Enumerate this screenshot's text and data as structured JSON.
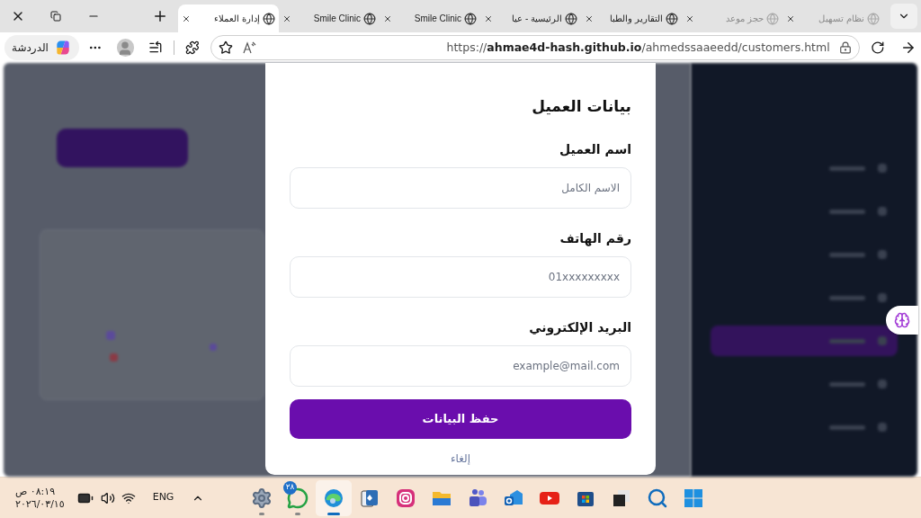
{
  "tabs": [
    {
      "title": "نظام تسهيل",
      "selected": false,
      "dimmed": true
    },
    {
      "title": "حجز موعد",
      "selected": false,
      "dimmed": true
    },
    {
      "title": "التقارير والطبا",
      "selected": false,
      "dimmed": false
    },
    {
      "title": "الرئيسية - عيا",
      "selected": false,
      "dimmed": false
    },
    {
      "title": "Smile Clinic",
      "selected": false,
      "dimmed": false
    },
    {
      "title": "Smile Clinic",
      "selected": false,
      "dimmed": false
    },
    {
      "title": "إدارة العملاء",
      "selected": true,
      "dimmed": false
    }
  ],
  "toolbar": {
    "copilot_label": "الدردشة",
    "url": "https://**ahmae4d-hash.github.io**/ahmedssaaeedd/customers.html"
  },
  "sidebar": {
    "items": [
      {
        "selected": false
      },
      {
        "selected": false
      },
      {
        "selected": false
      },
      {
        "selected": false
      },
      {
        "selected": true
      },
      {
        "selected": false
      },
      {
        "selected": false
      }
    ]
  },
  "modal": {
    "title": "بيانات العميل",
    "fields": [
      {
        "label": "اسم العميل",
        "placeholder": "الاسم الكامل"
      },
      {
        "label": "رقم الهاتف",
        "placeholder": "01xxxxxxxxx"
      },
      {
        "label": "البريد الإلكتروني",
        "placeholder": "example@mail.com"
      }
    ],
    "save_button": "حفظ البيانات",
    "cancel_link": "إلغاء"
  },
  "taskbar": {
    "time": "٠٨:١٩ ص",
    "date": "٢٠٢٦/٠٣/١٥",
    "language": "ENG",
    "apps": [
      {
        "kind": "settings",
        "open": true,
        "focused": false
      },
      {
        "kind": "whatsapp",
        "open": true,
        "focused": false,
        "badge": "٢٨"
      },
      {
        "kind": "edge",
        "open": true,
        "focused": true
      },
      {
        "kind": "solitaire",
        "open": false,
        "focused": false
      },
      {
        "kind": "instagram",
        "open": false,
        "focused": false
      },
      {
        "kind": "folder",
        "open": false,
        "focused": false
      },
      {
        "kind": "teams",
        "open": false,
        "focused": false
      },
      {
        "kind": "outlook",
        "open": false,
        "focused": false
      },
      {
        "kind": "youtube",
        "open": false,
        "focused": false
      },
      {
        "kind": "store",
        "open": false,
        "focused": false
      },
      {
        "kind": "taskview",
        "open": false,
        "focused": false
      },
      {
        "kind": "search",
        "open": false,
        "focused": false
      },
      {
        "kind": "windows",
        "open": false,
        "focused": false
      }
    ]
  }
}
